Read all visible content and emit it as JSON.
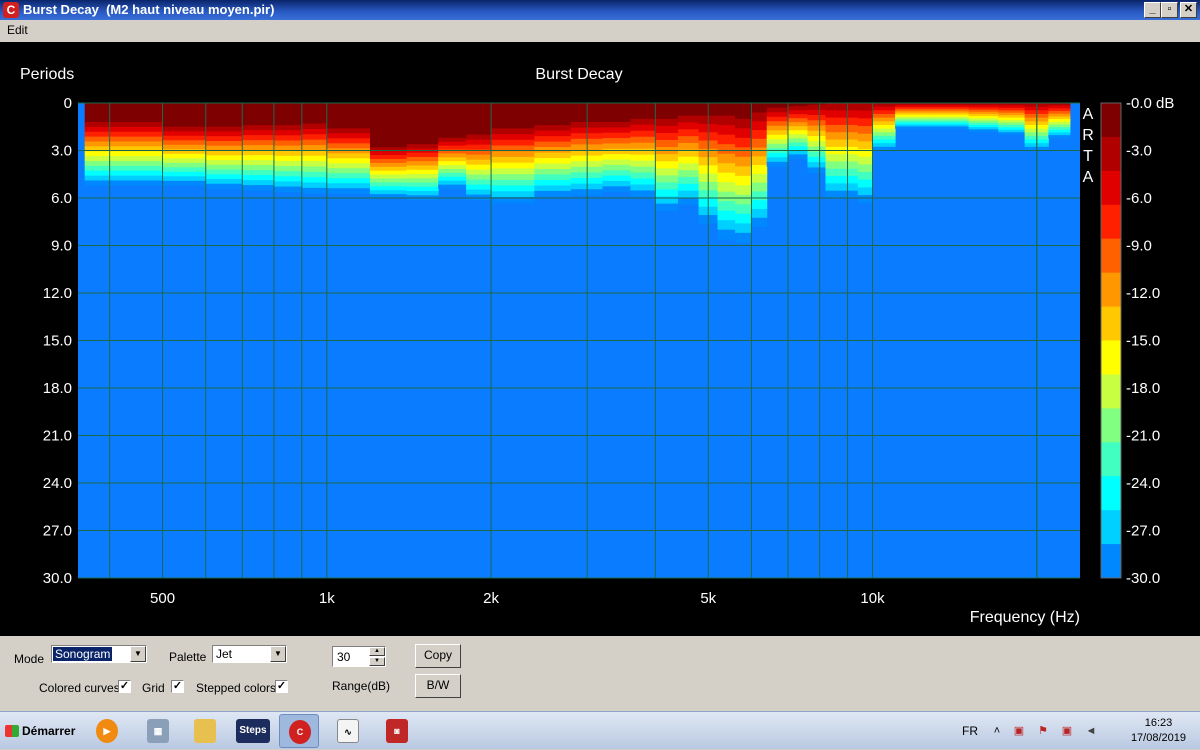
{
  "window": {
    "title": "Burst Decay  (M2 haut niveau moyen.pir)",
    "minimize_label": "_",
    "restore_label": "▫",
    "close_label": "✕"
  },
  "menu": {
    "edit": "Edit"
  },
  "chart_data": {
    "type": "heatmap",
    "title": "Burst Decay",
    "ylabel": "Periods",
    "xlabel": "Frequency (Hz)",
    "x_scale": "log",
    "xlim": [
      350,
      24000
    ],
    "ylim": [
      0,
      30
    ],
    "y_ticks": [
      "0",
      "3.0",
      "6.0",
      "9.0",
      "12.0",
      "15.0",
      "18.0",
      "21.0",
      "24.0",
      "27.0",
      "30.0"
    ],
    "x_ticks": [
      "500",
      "1k",
      "2k",
      "5k",
      "10k"
    ],
    "x_tick_values": [
      500,
      1000,
      2000,
      5000,
      10000
    ],
    "grid": true,
    "vertical_side_text": [
      "A",
      "R",
      "T",
      "A"
    ],
    "colorbar": {
      "range_db": [
        -30,
        0
      ],
      "labels": [
        "-0.0 dB",
        "-3.0",
        "-6.0",
        "-9.0",
        "-12.0",
        "-15.0",
        "-18.0",
        "-21.0",
        "-24.0",
        "-27.0",
        "-30.0"
      ],
      "colors": [
        "#7f0000",
        "#b00000",
        "#e00000",
        "#ff2000",
        "#ff6000",
        "#ff9800",
        "#ffc800",
        "#ffff00",
        "#c8ff40",
        "#80ff80",
        "#40ffc0",
        "#00ffff",
        "#00d0ff",
        "#0088ff"
      ]
    },
    "palette": "Jet",
    "background_color": "#0a7cff",
    "decay_profile": {
      "frequency_hz": [
        360,
        500,
        600,
        700,
        800,
        900,
        1000,
        1200,
        1400,
        1600,
        1800,
        2000,
        2400,
        2800,
        3200,
        3600,
        4000,
        4400,
        4800,
        5200,
        5600,
        6000,
        6400,
        7000,
        7600,
        8200,
        8800,
        9400,
        10000,
        11000,
        13000,
        15000,
        17000,
        19000,
        21000,
        23000
      ],
      "periods_to_minus_3db": [
        1.2,
        1.5,
        1.5,
        1.4,
        1.4,
        1.3,
        1.6,
        2.8,
        2.6,
        2.2,
        2.0,
        1.6,
        1.4,
        1.2,
        1.2,
        1.0,
        1.0,
        0.8,
        0.8,
        0.8,
        1.0,
        0.6,
        0.3,
        0.2,
        0.1,
        0.0,
        0.0,
        0.0,
        0.0,
        0.0,
        0.0,
        0.0,
        0.0,
        0.0,
        0.0,
        0.0
      ],
      "periods_to_minus_30db": [
        5.2,
        5.2,
        5.4,
        5.5,
        5.6,
        5.7,
        5.7,
        6.0,
        6.1,
        5.4,
        6.1,
        6.3,
        5.9,
        5.8,
        5.6,
        5.9,
        6.8,
        6.4,
        7.6,
        8.6,
        8.8,
        7.8,
        4.0,
        3.5,
        4.4,
        6.0,
        6.0,
        6.3,
        3.0,
        1.6,
        1.6,
        1.8,
        2.0,
        3.0,
        2.2,
        0.0
      ]
    }
  },
  "controls": {
    "mode_label": "Mode",
    "mode_value": "Sonogram",
    "palette_label": "Palette",
    "palette_value": "Jet",
    "range_value": "30",
    "range_label": "Range(dB)",
    "copy_label": "Copy",
    "bw_label": "B/W",
    "colored_curves_label": "Colored curves",
    "colored_curves_checked": "✓",
    "grid_label": "Grid",
    "grid_checked": "✓",
    "stepped_colors_label": "Stepped colors",
    "stepped_colors_checked": "✓"
  },
  "taskbar": {
    "start_label": "Démarrer",
    "steps_label": "Steps",
    "language": "FR",
    "time": "16:23",
    "date": "17/08/2019",
    "tray_chevron": "˄"
  }
}
